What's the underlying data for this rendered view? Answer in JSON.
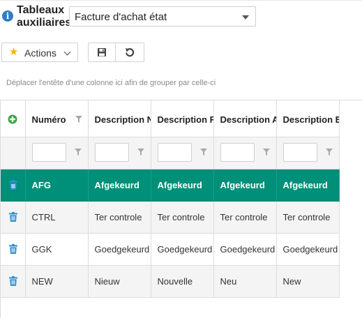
{
  "header": {
    "title_line1": "Tableaux",
    "title_line2": "auxiliaires",
    "info_icon_glyph": "i",
    "table_select": {
      "selected": "Facture d'achat état"
    }
  },
  "toolbar": {
    "actions_label": "Actions",
    "save_icon": "floppy-disk-icon",
    "undo_icon": "undo-icon"
  },
  "grid": {
    "group_hint": "Déplacer l'entête d'une colonne ici afin de grouper par celle-ci",
    "columns": [
      {
        "label": "Numéro"
      },
      {
        "label": "Description NL"
      },
      {
        "label": "Description FR"
      },
      {
        "label": "Description AL"
      },
      {
        "label": "Description EN"
      }
    ],
    "rows": [
      {
        "cells": [
          "AFG",
          "Afgekeurd",
          "Afgekeurd",
          "Afgekeurd",
          "Afgekeurd"
        ],
        "selected": true
      },
      {
        "cells": [
          "CTRL",
          "Ter controle",
          "Ter controle",
          "Ter controle",
          "Ter controle"
        ],
        "selected": false
      },
      {
        "cells": [
          "GGK",
          "Goedgekeurd",
          "Goedgekeurd",
          "Goedgekeurd",
          "Goedgekeurd"
        ],
        "selected": false
      },
      {
        "cells": [
          "NEW",
          "Nieuw",
          "Nouvelle",
          "Neu",
          "New"
        ],
        "selected": false
      }
    ]
  },
  "colors": {
    "selected_row": "#008f78",
    "add_icon": "#3aa845",
    "trash_icon": "#2b8fd6",
    "info_icon": "#2f7ec4",
    "star_icon": "#f4b400"
  }
}
